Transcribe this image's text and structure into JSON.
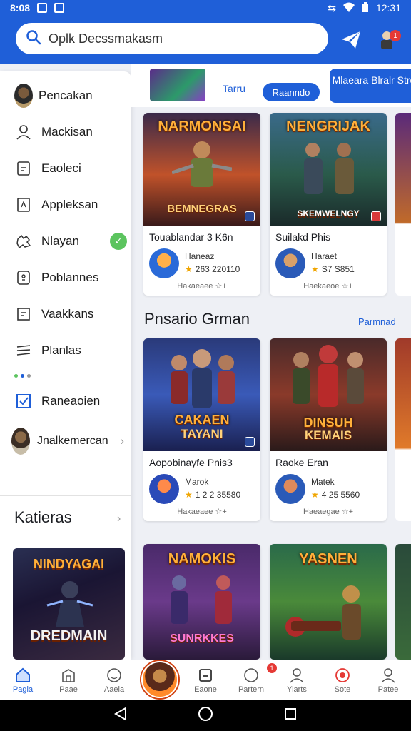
{
  "status": {
    "time": "8:08",
    "clock_right": "12:31"
  },
  "search": {
    "placeholder": "Oplk Decssmakasm"
  },
  "header": {
    "notification_count": "1"
  },
  "drawer": {
    "profile_name": "Pencakan",
    "items": [
      {
        "label": "Mackisan",
        "icon": "person-icon"
      },
      {
        "label": "Eaoleci",
        "icon": "clipboard-icon"
      },
      {
        "label": "Appleksan",
        "icon": "document-icon"
      },
      {
        "label": "Nlayan",
        "icon": "puzzle-icon"
      },
      {
        "label": "Poblannes",
        "icon": "box-icon"
      },
      {
        "label": "Vaakkans",
        "icon": "square-lines-icon"
      },
      {
        "label": "Planlas",
        "icon": "stack-icon"
      },
      {
        "label": "Raneaoien",
        "icon": "check-box-icon"
      }
    ],
    "account_name": "Jnalkemercan",
    "section_title": "Katieras",
    "featured_title": "NINDYAGAI",
    "featured_subtitle": "DREDMAIN"
  },
  "chips": {
    "text": "Tarru",
    "button": "Raanndo",
    "big_button": "Mlaeara Blralr Stre"
  },
  "row1": [
    {
      "art_title": "NARMONSAI",
      "art_sub": "BEMNEGRAS",
      "name": "Touablandar 3 K6n",
      "dev": "Haneaz",
      "stat": "263 220110",
      "meta": "Hakaeaee ☆+"
    },
    {
      "art_title": "NENGRIJAK",
      "art_sub": "SKEMWELNGY",
      "name": "Suilakd Phis",
      "dev": "Haraet",
      "stat": "S7 S851",
      "meta": "Haekaeoe ☆+"
    }
  ],
  "section": {
    "title": "Pnsario Grman",
    "link": "Parmnad"
  },
  "row2": [
    {
      "art_title": "CAKAEN",
      "art_sub": "TAYANI",
      "name": "Aopobinayfe Pnis3",
      "dev": "Marok",
      "stat": "1 2 2 35580",
      "meta": "Hakaeaee ☆+"
    },
    {
      "art_title": "DINSUH",
      "art_sub": "KEMAIS",
      "name": "Raoke Eran",
      "dev": "Matek",
      "stat": "4 25 5560",
      "meta": "Haeaegae ☆+"
    }
  ],
  "row3": [
    {
      "art_title": "NAMOKIS",
      "art_sub": "SUNRKKES"
    },
    {
      "art_title": "YASNEN",
      "art_sub": ""
    }
  ],
  "bottom_nav": [
    {
      "label": "Pagla",
      "icon": "home-icon"
    },
    {
      "label": "Paae",
      "icon": "building-icon"
    },
    {
      "label": "Aaela",
      "icon": "face-icon"
    },
    {
      "label": "",
      "icon": "profile-hero-icon"
    },
    {
      "label": "Eaone",
      "icon": "inbox-icon"
    },
    {
      "label": "Partern",
      "icon": "chat-icon",
      "badge": "1"
    },
    {
      "label": "Yiarts",
      "icon": "user-icon"
    },
    {
      "label": "Sote",
      "icon": "target-icon"
    },
    {
      "label": "Patee",
      "icon": "account-icon"
    }
  ],
  "colors": {
    "brand": "#1f5fd8",
    "accent_green": "#5cc45f",
    "badge_red": "#e53935"
  }
}
